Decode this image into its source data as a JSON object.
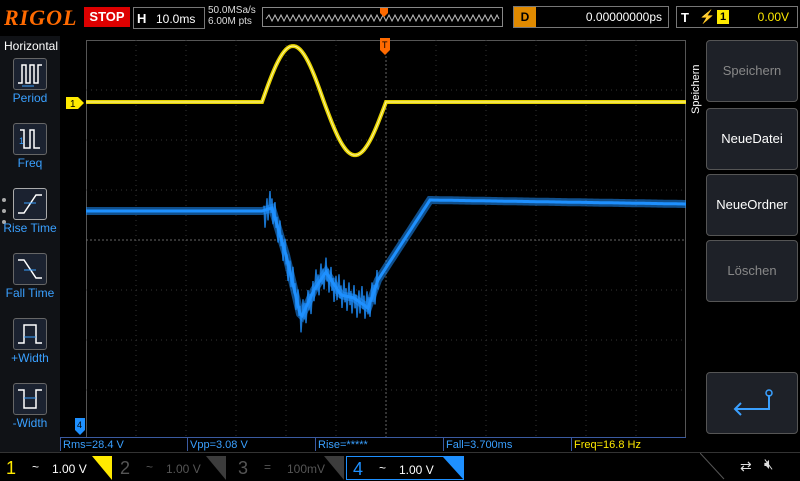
{
  "top": {
    "brand": "RIGOL",
    "run_state": "STOP",
    "horizontal": {
      "label": "H",
      "timebase": "10.0ms"
    },
    "sample_rate": "50.0MSa/s",
    "memory_depth": "6.00M pts",
    "delay": {
      "label": "D",
      "value": "0.00000000ps"
    },
    "trigger": {
      "label": "T",
      "source": "1",
      "level": "0.00V",
      "edge_icon": "rising-edge-icon"
    }
  },
  "left_menu": {
    "title": "Horizontal",
    "items": [
      {
        "label": "Period",
        "icon": "period-icon"
      },
      {
        "label": "Freq",
        "icon": "freq-icon"
      },
      {
        "label": "Rise Time",
        "icon": "rise-time-icon"
      },
      {
        "label": "Fall Time",
        "icon": "fall-time-icon"
      },
      {
        "label": "+Width",
        "icon": "pos-width-icon"
      },
      {
        "label": "-Width",
        "icon": "neg-width-icon"
      }
    ]
  },
  "right_menu": {
    "title": "Speichern",
    "buttons": [
      {
        "label": "Speichern",
        "enabled": false
      },
      {
        "label": "NeueDatei",
        "enabled": true
      },
      {
        "label": "NeueOrdner",
        "enabled": true
      },
      {
        "label": "Löschen",
        "enabled": false
      }
    ],
    "back_icon": "return-arrow-icon"
  },
  "markers": {
    "ch1": "1",
    "ch4": "4",
    "trigger": "T"
  },
  "measurements": [
    {
      "text": "Rms=28.4 V",
      "color": "#3aa0ff"
    },
    {
      "text": "Vpp=3.08 V",
      "color": "#3aa0ff"
    },
    {
      "text": "Rise=*****",
      "color": "#3aa0ff"
    },
    {
      "text": "Fall=3.700ms",
      "color": "#3aa0ff"
    },
    {
      "text": "Freq=16.8 Hz",
      "color": "#ffea00"
    }
  ],
  "channels": [
    {
      "num": "1",
      "coupling": "~",
      "scale": "1.00 V",
      "color": "#ffea00",
      "active": true
    },
    {
      "num": "2",
      "coupling": "~",
      "scale": "1.00 V",
      "color": "#3c3c3c",
      "active": false
    },
    {
      "num": "3",
      "coupling": "=",
      "scale": "100mV",
      "color": "#3c3c3c",
      "active": false
    },
    {
      "num": "4",
      "coupling": "~",
      "scale": "1.00 V",
      "color": "#1e90ff",
      "active": true
    }
  ],
  "colors": {
    "ch1": "#ffea00",
    "ch4": "#1e90ff",
    "accent": "#ff6a00"
  }
}
